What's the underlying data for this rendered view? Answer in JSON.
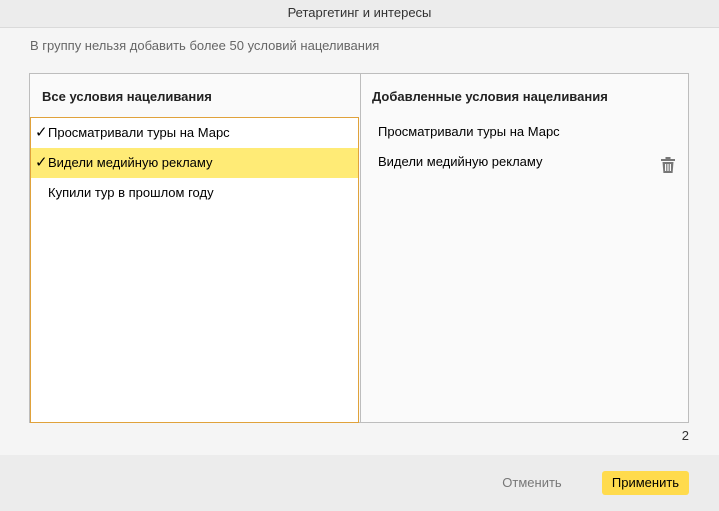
{
  "dialog": {
    "title": "Ретаргетинг и интересы",
    "notice": "В группу нельзя добавить более 50 условий нацеливания"
  },
  "left_panel": {
    "header": "Все условия нацеливания",
    "items": [
      {
        "label": "Просматривали туры на Марс",
        "checked": true,
        "highlighted": false
      },
      {
        "label": "Видели медийную рекламу",
        "checked": true,
        "highlighted": true
      },
      {
        "label": "Купили тур в прошлом году",
        "checked": false,
        "highlighted": false
      }
    ]
  },
  "right_panel": {
    "header": "Добавленные условия нацеливания",
    "items": [
      {
        "label": "Просматривали туры на Марс"
      },
      {
        "label": "Видели медийную рекламу"
      }
    ],
    "trash_icon": "trash-icon"
  },
  "count": "2",
  "footer": {
    "cancel_label": "Отменить",
    "apply_label": "Применить"
  },
  "colors": {
    "highlight": "#ffeb76",
    "focus_border": "#e0a23b",
    "apply_button": "#ffdb4d"
  },
  "icons": {
    "check": "✓"
  }
}
